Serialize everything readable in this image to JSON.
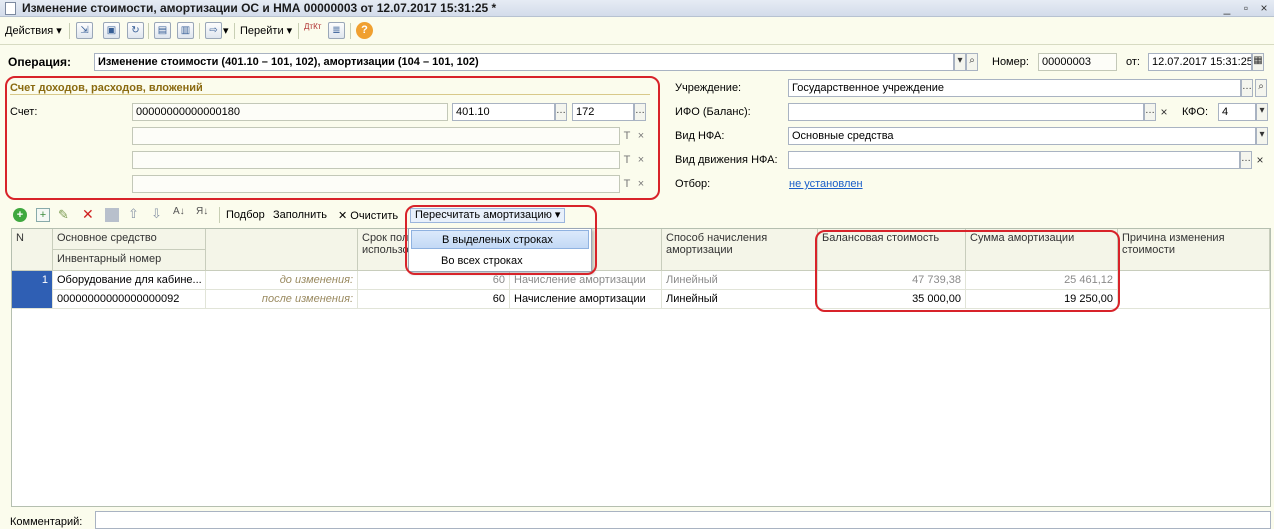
{
  "window": {
    "title": "Изменение стоимости, амортизации ОС и НМА 00000003 от 12.07.2017 15:31:25 *",
    "controls": [
      "_",
      "▫",
      "×"
    ]
  },
  "toolbar": {
    "actions_label": "Действия",
    "goto_label": "Перейти",
    "dtkt_label": "ДтКт",
    "help_label": "?"
  },
  "operation": {
    "label": "Операция:",
    "value": "Изменение стоимости (401.10 – 101, 102), амортизации (104 – 101, 102)"
  },
  "number": {
    "label": "Номер:",
    "value": "00000003"
  },
  "date": {
    "label": "от:",
    "value": "12.07.2017 15:31:25"
  },
  "account_group": {
    "title": "Счет доходов, расходов, вложений",
    "schet_label": "Счет:",
    "schet_value": "00000000000000180",
    "kps_value": "401.10",
    "kosgu_value": "172",
    "t_glyph": "T",
    "x_glyph": "×"
  },
  "right_fields": {
    "institution_label": "Учреждение:",
    "institution_value": "Государственное учреждение",
    "ifo_label": "ИФО (Баланс):",
    "ifo_value": "",
    "kfo_label": "КФО:",
    "kfo_value": "4",
    "nfa_label": "Вид НФА:",
    "nfa_value": "Основные средства",
    "movement_label": "Вид движения НФА:",
    "movement_value": "",
    "filter_label": "Отбор:",
    "filter_value": "не установлен"
  },
  "table_toolbar": {
    "pick_label": "Подбор",
    "fill_label": "Заполнить",
    "clear_label": "Очистить",
    "recalc_label": "Пересчитать амортизацию"
  },
  "dropdown": {
    "items": [
      "В выделеных строках",
      "Во всех строках"
    ]
  },
  "table": {
    "headers": {
      "n": "N",
      "asset": "Основное средство",
      "inventory": "Инвентарный номер",
      "term": "Срок полезного использования",
      "method_hidden": "...ления",
      "calc_method": "Способ начисления амортизации",
      "balance": "Балансовая стоимость",
      "amort": "Сумма амортизации",
      "reason": "Причина изменения стоимости"
    },
    "rows": [
      {
        "n": "1",
        "asset": "Оборудование для кабине...",
        "inventory": "00000000000000000092",
        "before_label": "до изменения:",
        "after_label": "после изменения:",
        "term_before": "60",
        "term_after": "60",
        "op_before": "Начисление амортизации",
        "op_after": "Начисление амортизации",
        "method_before": "Линейный",
        "method_after": "Линейный",
        "balance_before": "47 739,38",
        "balance_after": "35 000,00",
        "amort_before": "25 461,12",
        "amort_after": "19 250,00"
      }
    ]
  },
  "comment": {
    "label": "Комментарий:",
    "value": ""
  },
  "colors": {
    "highlight": "#d8232a",
    "background": "#fbfced",
    "link": "#1a5ec8"
  }
}
